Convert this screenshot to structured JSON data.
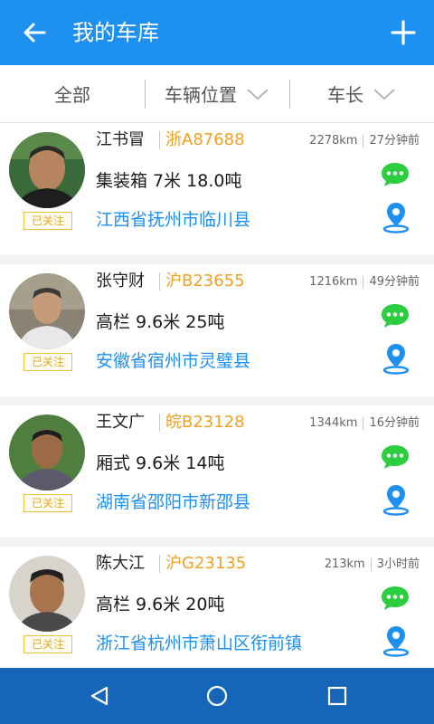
{
  "header": {
    "title": "我的车库",
    "back_icon": "arrow-left-icon",
    "add_icon": "plus-icon"
  },
  "filters": {
    "all": "全部",
    "location": "车辆位置",
    "length": "车长"
  },
  "vehicles": [
    {
      "name": "江书冒",
      "plate": "浙A87688",
      "distance": "2278km",
      "time": "27分钟前",
      "spec": "集装箱 7米 18.0吨",
      "address": "江西省抚州市临川县",
      "followed": "已关注"
    },
    {
      "name": "张守财",
      "plate": "沪B23655",
      "distance": "1216km",
      "time": "49分钟前",
      "spec": "高栏 9.6米 25吨",
      "address": "安徽省宿州市灵璧县",
      "followed": "已关注"
    },
    {
      "name": "王文广",
      "plate": "皖B23128",
      "distance": "1344km",
      "time": "16分钟前",
      "spec": "厢式 9.6米 14吨",
      "address": "湖南省邵阳市新邵县",
      "followed": "已关注"
    },
    {
      "name": "陈大江",
      "plate": "沪G23135",
      "distance": "213km",
      "time": "3小时前",
      "spec": "高栏 9.6米 20吨",
      "address": "浙江省杭州市萧山区衔前镇",
      "followed": "已关注"
    }
  ],
  "colors": {
    "primary": "#1e90f0",
    "plate": "#f0a020",
    "chat": "#2ecc40",
    "badge": "#e0a820",
    "navbar": "#1565b8"
  },
  "navbar": {
    "back_icon": "triangle-back-icon",
    "home_icon": "circle-home-icon",
    "recents_icon": "square-recents-icon"
  }
}
